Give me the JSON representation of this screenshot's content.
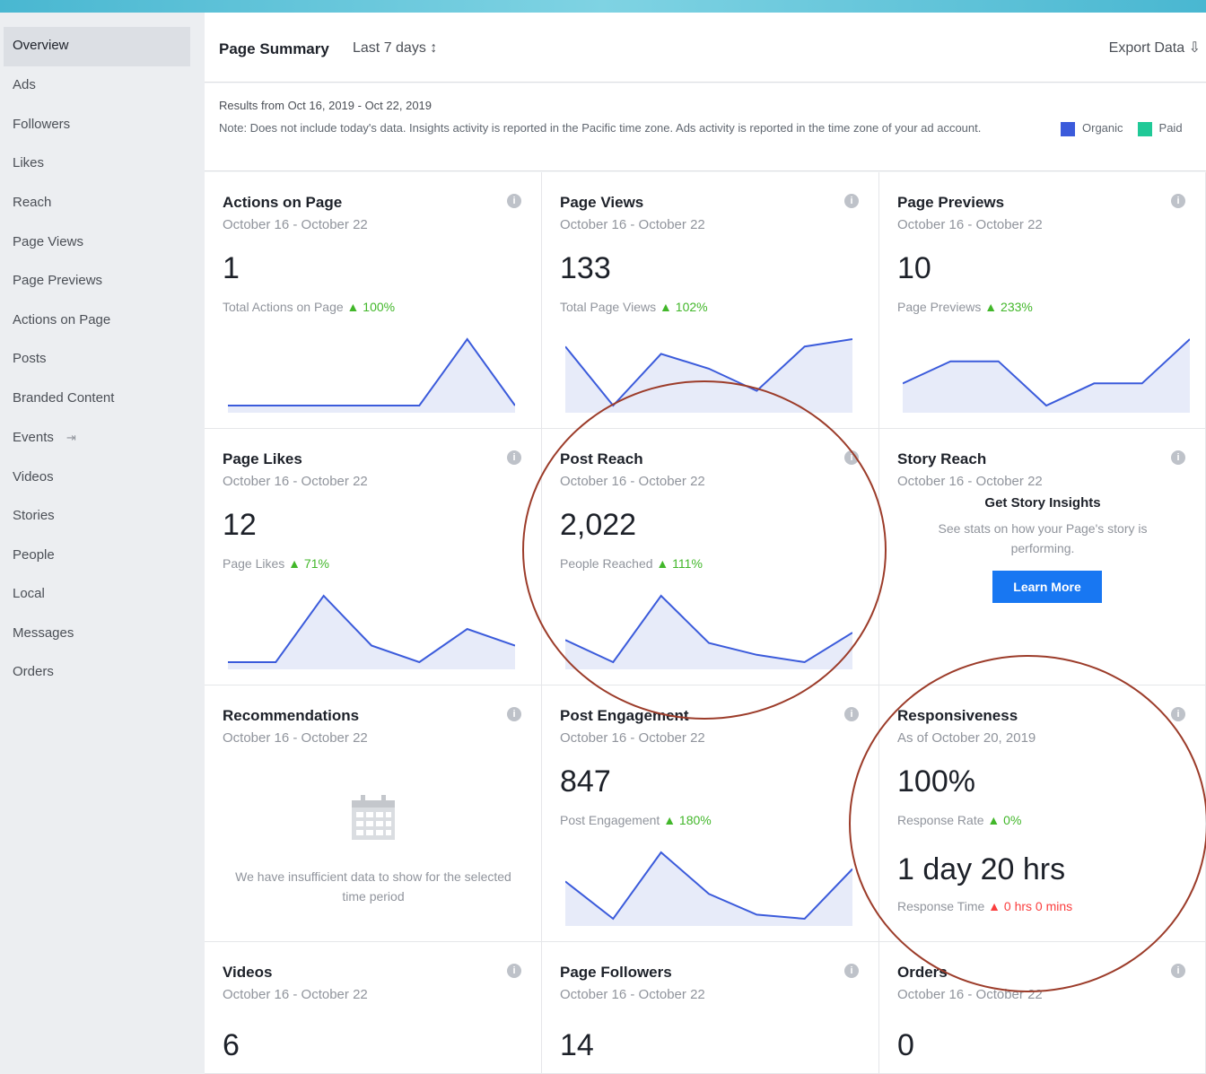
{
  "sidebar": {
    "items": [
      {
        "label": "Overview"
      },
      {
        "label": "Ads"
      },
      {
        "label": "Followers"
      },
      {
        "label": "Likes"
      },
      {
        "label": "Reach"
      },
      {
        "label": "Page Views"
      },
      {
        "label": "Page Previews"
      },
      {
        "label": "Actions on Page"
      },
      {
        "label": "Posts"
      },
      {
        "label": "Branded Content"
      },
      {
        "label": "Events"
      },
      {
        "label": "Videos"
      },
      {
        "label": "Stories"
      },
      {
        "label": "People"
      },
      {
        "label": "Local"
      },
      {
        "label": "Messages"
      },
      {
        "label": "Orders"
      }
    ]
  },
  "header": {
    "title": "Page Summary",
    "range_label": "Last 7 days ↕",
    "export_label": "Export Data ⇩"
  },
  "results": {
    "range": "Results from Oct 16, 2019 - Oct 22, 2019",
    "note": "Note: Does not include today's data. Insights activity is reported in the Pacific time zone. Ads activity is reported in the time zone of your ad account.",
    "legend": {
      "organic": "Organic",
      "paid": "Paid"
    }
  },
  "colors": {
    "organic": "#3b5bdb",
    "paid": "#20c997",
    "accent": "#1877f2",
    "annotation": "#9c3c2a"
  },
  "cards": {
    "actions": {
      "title": "Actions on Page",
      "date": "October 16 - October 22",
      "value": "1",
      "label": "Total Actions on Page",
      "change": "▲ 100%",
      "spark": [
        0,
        0,
        0,
        0,
        0,
        1,
        0
      ]
    },
    "views": {
      "title": "Page Views",
      "date": "October 16 - October 22",
      "value": "133",
      "label": "Total Page Views",
      "change": "▲ 102%",
      "spark": [
        22,
        14,
        21,
        19,
        16,
        22,
        23
      ]
    },
    "previews": {
      "title": "Page Previews",
      "date": "October 16 - October 22",
      "value": "10",
      "label": "Page Previews",
      "change": "▲ 233%",
      "spark": [
        2,
        3,
        3,
        1,
        2,
        2,
        4
      ]
    },
    "likes": {
      "title": "Page Likes",
      "date": "October 16 - October 22",
      "value": "12",
      "label": "Page Likes",
      "change": "▲ 71%",
      "spark": [
        0,
        0,
        4,
        1,
        0,
        2,
        1
      ]
    },
    "reach": {
      "title": "Post Reach",
      "date": "October 16 - October 22",
      "value": "2,022",
      "label": "People Reached",
      "change": "▲ 111%",
      "spark": [
        400,
        250,
        700,
        380,
        300,
        250,
        450
      ]
    },
    "story": {
      "title": "Story Reach",
      "date": "October 16 - October 22",
      "promo_title": "Get Story Insights",
      "promo_text": "See stats on how your Page's story is performing.",
      "button": "Learn More"
    },
    "recommendations": {
      "title": "Recommendations",
      "date": "October 16 - October 22",
      "empty_text": "We have insufficient data to show for the selected time period"
    },
    "engagement": {
      "title": "Post Engagement",
      "date": "October 16 - October 22",
      "value": "847",
      "label": "Post Engagement",
      "change": "▲ 180%",
      "spark": [
        150,
        60,
        220,
        120,
        70,
        60,
        180
      ]
    },
    "responsiveness": {
      "title": "Responsiveness",
      "date": "As of October 20, 2019",
      "value": "100%",
      "label": "Response Rate",
      "change": "▲ 0%",
      "value2": "1 day 20 hrs",
      "label2": "Response Time",
      "change2": "▲ 0 hrs 0 mins"
    },
    "videos": {
      "title": "Videos",
      "date": "October 16 - October 22",
      "value": "6"
    },
    "followers": {
      "title": "Page Followers",
      "date": "October 16 - October 22",
      "value": "14"
    },
    "orders": {
      "title": "Orders",
      "date": "October 16 - October 22",
      "value": "0"
    }
  }
}
